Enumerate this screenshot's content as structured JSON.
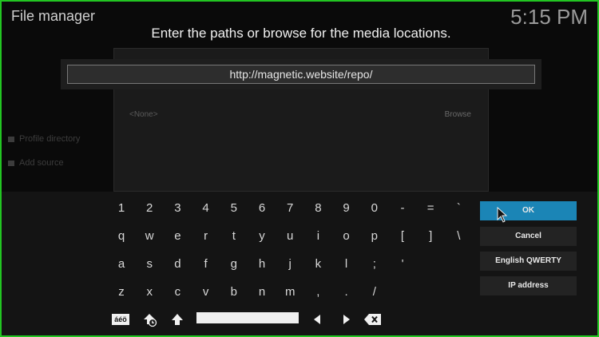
{
  "window": {
    "title": "File manager",
    "clock": "5:15 PM"
  },
  "background": {
    "none_label": "<None>",
    "browse_label": "Browse",
    "left_items": [
      "Profile directory",
      "Add source"
    ]
  },
  "dialog": {
    "heading": "Enter the paths or browse for the media locations.",
    "input_value": "http://magnetic.website/repo/"
  },
  "keyboard": {
    "rows": [
      [
        "1",
        "2",
        "3",
        "4",
        "5",
        "6",
        "7",
        "8",
        "9",
        "0",
        "-",
        "=",
        "`"
      ],
      [
        "q",
        "w",
        "e",
        "r",
        "t",
        "y",
        "u",
        "i",
        "o",
        "p",
        "[",
        "]",
        "\\"
      ],
      [
        "a",
        "s",
        "d",
        "f",
        "g",
        "h",
        "j",
        "k",
        "l",
        ";",
        "'"
      ],
      [
        "z",
        "x",
        "c",
        "v",
        "b",
        "n",
        "m",
        ",",
        ".",
        "/"
      ]
    ],
    "accent_label": "áéö",
    "icons": [
      "layout-switch-icon",
      "shift-icon",
      "space-bar",
      "arrow-left-icon",
      "arrow-right-icon",
      "backspace-icon"
    ]
  },
  "buttons": {
    "ok": "OK",
    "cancel": "Cancel",
    "layout": "English QWERTY",
    "ip": "IP address"
  },
  "colors": {
    "accent": "#1b85b6",
    "border": "#22c522"
  }
}
